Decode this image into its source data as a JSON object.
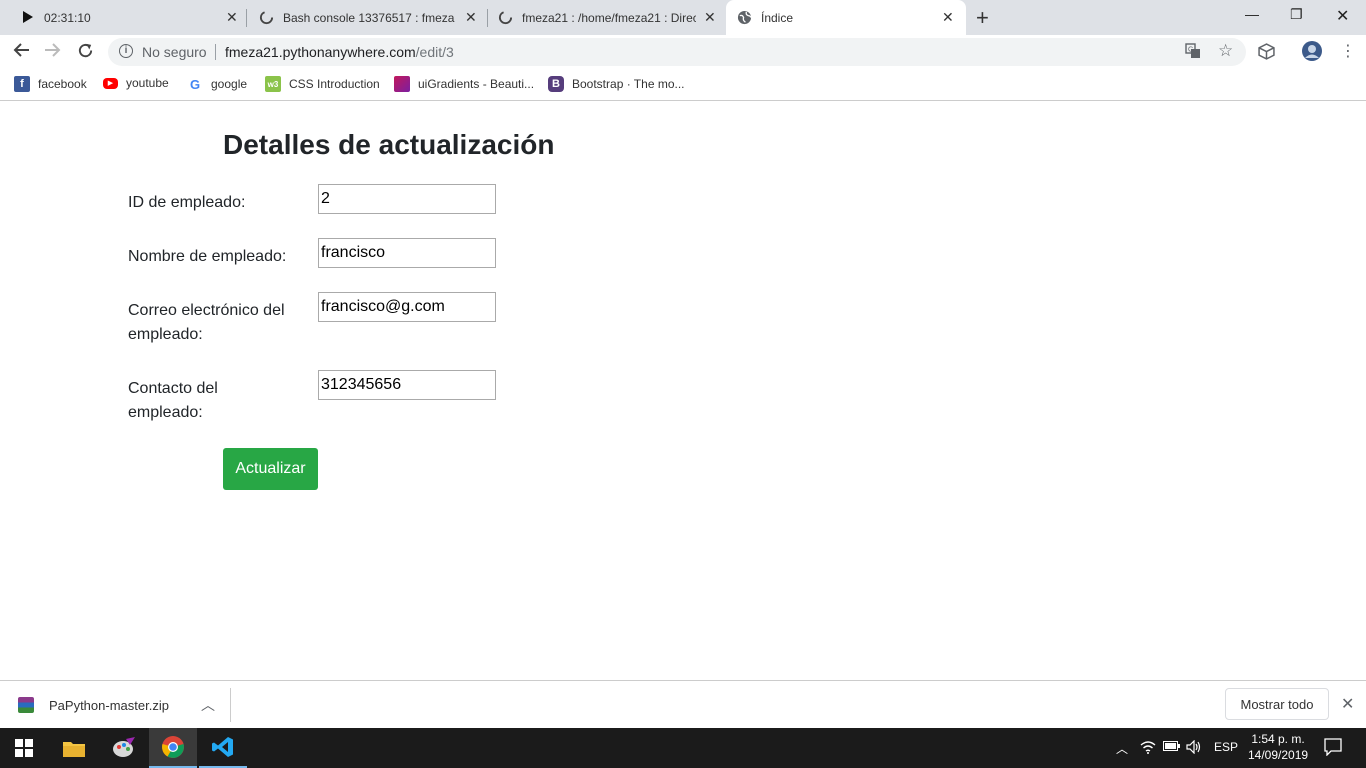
{
  "browser": {
    "tabs": [
      {
        "title": "02:31:10",
        "icon": "timer-icon",
        "active": false
      },
      {
        "title": "Bash console 13376517 : fmeza2",
        "icon": "loading-icon",
        "active": false
      },
      {
        "title": "fmeza21 : /home/fmeza21 : Direc",
        "icon": "loading-icon",
        "active": false
      },
      {
        "title": "Índice",
        "icon": "globe-icon",
        "active": true
      }
    ],
    "address": {
      "security": "No seguro",
      "host": "fmeza21.pythonanywhere.com",
      "path": "/edit/3"
    },
    "bookmarks": [
      {
        "label": "facebook",
        "icon": "facebook-icon",
        "color": "#3b5998"
      },
      {
        "label": "youtube",
        "icon": "youtube-icon",
        "color": "#ff0000"
      },
      {
        "label": "google",
        "icon": "google-icon",
        "color": "#4285f4"
      },
      {
        "label": "CSS Introduction",
        "icon": "w3schools-icon",
        "color": "#8bc34a"
      },
      {
        "label": "uiGradients - Beauti...",
        "icon": "uigradients-icon",
        "color": "#c2185b"
      },
      {
        "label": "Bootstrap · The mo...",
        "icon": "bootstrap-icon",
        "color": "#563d7c"
      }
    ]
  },
  "page": {
    "title": "Detalles de actualización",
    "fields": [
      {
        "label": "ID de empleado:",
        "value": "2"
      },
      {
        "label": "Nombre de empleado:",
        "value": "francisco"
      },
      {
        "label": "Correo electrónico del empleado:",
        "value": "francisco@g.com"
      },
      {
        "label": "Contacto del empleado:",
        "value": "312345656"
      }
    ],
    "submit_label": "Actualizar",
    "accent_color": "#28a745"
  },
  "downloads": {
    "file": "PaPython-master.zip",
    "show_all": "Mostrar todo"
  },
  "taskbar": {
    "language": "ESP",
    "time": "1:54 p. m.",
    "date": "14/09/2019"
  }
}
